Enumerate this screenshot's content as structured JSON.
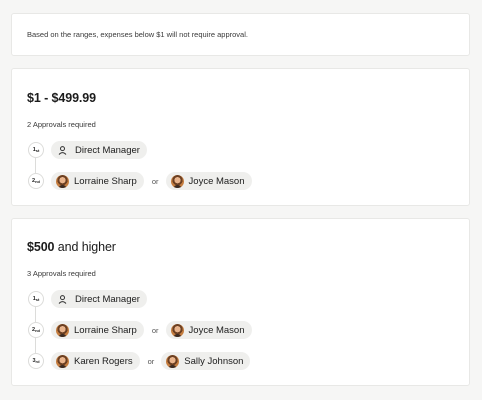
{
  "note": {
    "text": "Based on the ranges, expenses below $1 will not require approval."
  },
  "ranges": [
    {
      "title_bold": "$1 - $499.99",
      "title_rest": "",
      "approvals_required": "2 Approvals required",
      "steps": [
        {
          "num": "1",
          "suffix": "st",
          "approvers": [
            {
              "type": "role",
              "icon": "person-icon",
              "name": "Direct Manager"
            }
          ]
        },
        {
          "num": "2",
          "suffix": "nd",
          "approvers": [
            {
              "type": "user",
              "name": "Lorraine Sharp"
            },
            {
              "type": "user",
              "name": "Joyce Mason"
            }
          ]
        }
      ]
    },
    {
      "title_bold": "$500",
      "title_rest": " and higher",
      "approvals_required": "3 Approvals required",
      "steps": [
        {
          "num": "1",
          "suffix": "st",
          "approvers": [
            {
              "type": "role",
              "icon": "person-icon",
              "name": "Direct Manager"
            }
          ]
        },
        {
          "num": "2",
          "suffix": "nd",
          "approvers": [
            {
              "type": "user",
              "name": "Lorraine Sharp"
            },
            {
              "type": "user",
              "name": "Joyce Mason"
            }
          ]
        },
        {
          "num": "3",
          "suffix": "rd",
          "approvers": [
            {
              "type": "user",
              "name": "Karen Rogers"
            },
            {
              "type": "user",
              "name": "Sally Johnson"
            }
          ]
        }
      ]
    }
  ],
  "or_label": "or",
  "colors": {
    "card_bg": "#ffffff",
    "page_bg": "#f6f6f5",
    "chip_bg": "#efefed",
    "border": "#e8e8e6"
  }
}
